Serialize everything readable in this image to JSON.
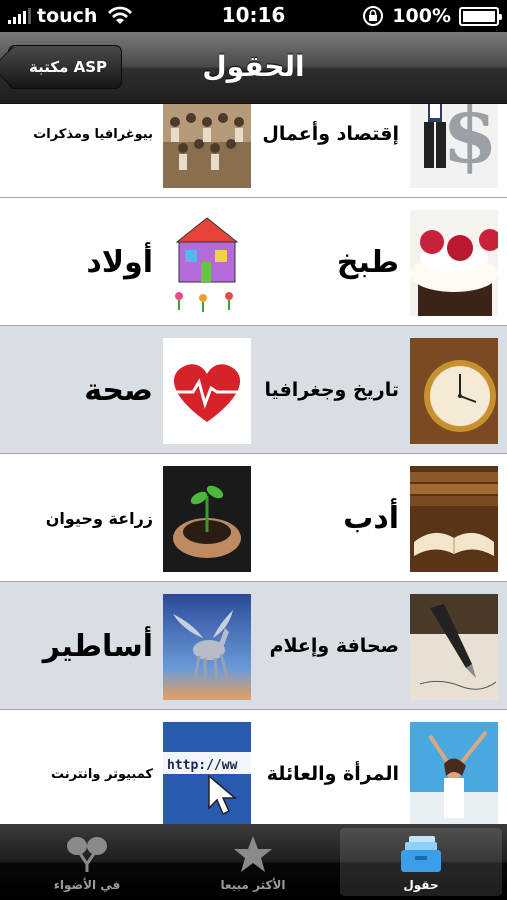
{
  "status_bar": {
    "carrier": "touch",
    "time": "10:16",
    "battery": "100%"
  },
  "nav": {
    "title": "الحقول",
    "back_label": "مكتبة ASP"
  },
  "rows": [
    {
      "right_label": "إقتصاد وأعمال",
      "right_icon": "dollar-businessman-image",
      "left_label": "بيوغرافيا ومذكرات",
      "left_icon": "vintage-group-photo-image"
    },
    {
      "right_label": "طبخ",
      "right_icon": "cupcake-image",
      "left_label": "أولاد",
      "left_icon": "child-house-drawing-image"
    },
    {
      "right_label": "تاريخ وجغرافيا",
      "right_icon": "pocket-watch-image",
      "left_label": "صحة",
      "left_icon": "heartbeat-heart-image"
    },
    {
      "right_label": "أدب",
      "right_icon": "open-books-image",
      "left_label": "زراعة وحيوان",
      "left_icon": "seedling-hands-image"
    },
    {
      "right_label": "صحافة وإعلام",
      "right_icon": "fountain-pen-image",
      "left_label": "أساطير",
      "left_icon": "pegasus-image"
    },
    {
      "right_label": "المرأة والعائلة",
      "right_icon": "happy-woman-image",
      "left_label": "كمبيوتر وانترنت",
      "left_icon": "browser-url-image"
    }
  ],
  "tabs": [
    {
      "label": "في الأضواء",
      "icon": "spotlight-icon"
    },
    {
      "label": "الأكثر مبيعا",
      "icon": "star-icon"
    },
    {
      "label": "حقول",
      "icon": "file-box-icon"
    }
  ]
}
